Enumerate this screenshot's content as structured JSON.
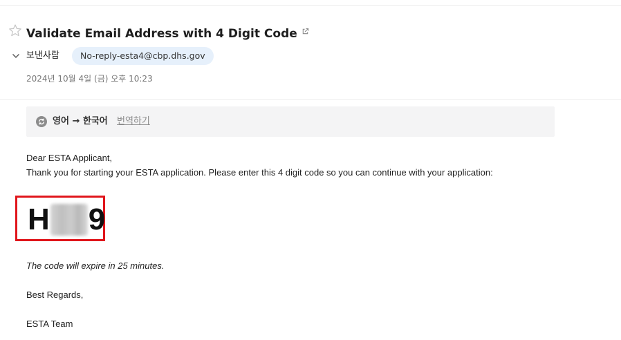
{
  "email": {
    "subject": "Validate Email Address with 4 Digit Code",
    "sender_label": "보낸사람",
    "sender_address": "No-reply-esta4@cbp.dhs.gov",
    "date": "2024년 10월 4일 (금) 오후 10:23"
  },
  "translation": {
    "languages": "영어 → 한국어",
    "action_label": "번역하기"
  },
  "message": {
    "greeting": "Dear ESTA Applicant,",
    "intro": "Thank you for starting your ESTA application. Please enter this 4 digit code so you can continue with your application:",
    "code_first": "H",
    "code_last": "9",
    "expiry_note": "The code will expire in 25 minutes.",
    "closing": "Best Regards,",
    "signature": "ESTA Team"
  },
  "colors": {
    "highlight_border": "#e0151b",
    "sender_chip_bg": "#e6f0fb",
    "translate_bar_bg": "#f4f4f5"
  },
  "icons": {
    "star": "star-outline-icon",
    "external": "external-link-icon",
    "chevron": "chevron-down-icon",
    "translate": "translate-icon"
  }
}
